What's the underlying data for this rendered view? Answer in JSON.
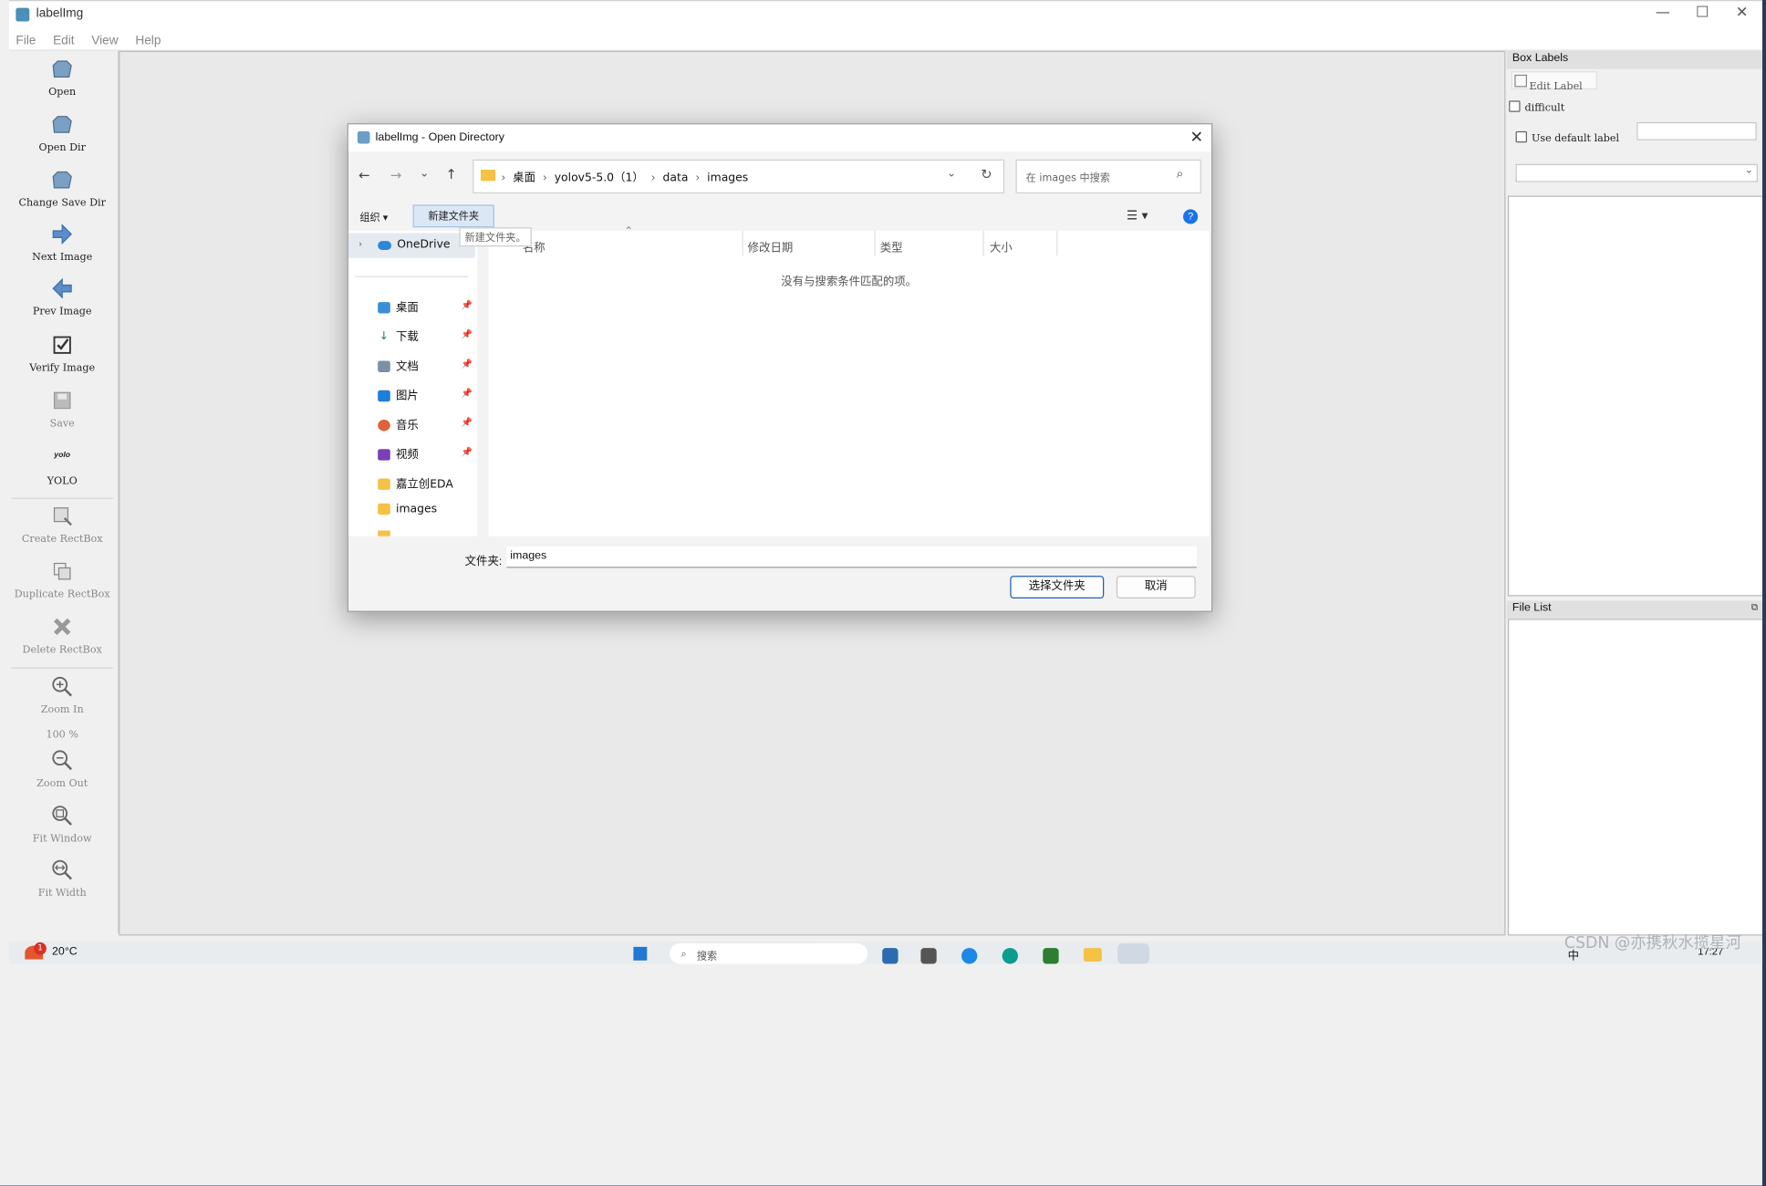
{
  "window": {
    "title": "labelImg",
    "controls": [
      "—",
      "☐",
      "✕"
    ]
  },
  "menu": [
    "File",
    "Edit",
    "View",
    "Help"
  ],
  "toolbar": {
    "open": "Open",
    "open_dir": "Open Dir",
    "change_save_dir": "Change Save Dir",
    "next_image": "Next Image",
    "prev_image": "Prev Image",
    "verify_image": "Verify Image",
    "save": "Save",
    "yolo_icon_text": "yolo",
    "yolo": "YOLO",
    "create_rectbox": "Create RectBox",
    "duplicate_rectbox": "Duplicate RectBox",
    "delete_rectbox": "Delete RectBox",
    "zoom_in": "Zoom In",
    "zoom_level": "100 %",
    "zoom_out": "Zoom Out",
    "fit_window": "Fit Window",
    "fit_width": "Fit Width"
  },
  "box_labels": {
    "title": "Box Labels",
    "edit_label": "Edit Label",
    "difficult": "difficult",
    "use_default_label": "Use default label",
    "default_label_value": ""
  },
  "file_list": {
    "title": "File List"
  },
  "dialog": {
    "title": "labelImg - Open Directory",
    "breadcrumb": [
      "桌面",
      "yolov5-5.0（1）",
      "data",
      "images"
    ],
    "search_placeholder": "在 images 中搜索",
    "organize": "组织 ▾",
    "new_folder": "新建文件夹",
    "tooltip": "新建文件夹。",
    "nav": {
      "onedrive": "OneDrive",
      "desktop": "桌面",
      "downloads": "下载",
      "documents": "文档",
      "pictures": "图片",
      "music": "音乐",
      "videos": "视频",
      "eda": "嘉立创EDA",
      "images": "images"
    },
    "columns": {
      "name": "名称",
      "modified": "修改日期",
      "type": "类型",
      "size": "大小"
    },
    "empty_message": "没有与搜索条件匹配的项。",
    "folder_label": "文件夹:",
    "folder_value": "images",
    "select_button": "选择文件夹",
    "cancel_button": "取消"
  },
  "taskbar": {
    "weather_badge": "1",
    "weather": "20°C",
    "search_placeholder": "搜索",
    "ime": "中",
    "clock": "17:27"
  },
  "watermark": "CSDN @亦携秋水揽星河"
}
